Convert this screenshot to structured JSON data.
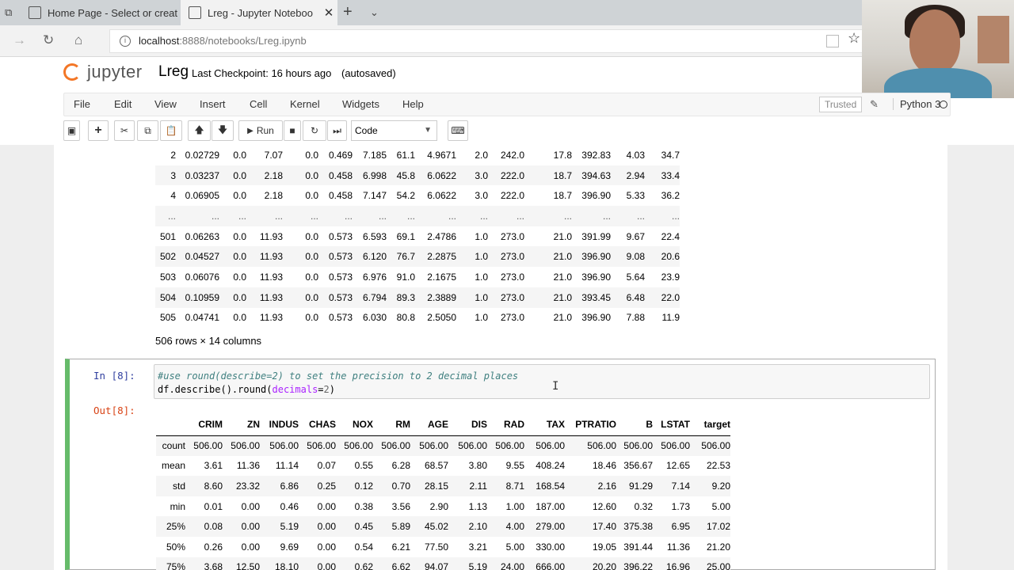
{
  "browser": {
    "tabs": [
      {
        "title": "Home Page - Select or creat"
      },
      {
        "title": "Lreg - Jupyter Noteboo"
      }
    ],
    "url": "localhost:8888/notebooks/Lreg.ipynb",
    "url_host": "localhost",
    "url_rest": ":8888/notebooks/Lreg.ipynb"
  },
  "jupyter": {
    "logo_text": "jupyter",
    "notebook_name": "Lreg",
    "checkpoint": "Last Checkpoint: 16 hours ago",
    "autosave": "(autosaved)",
    "menu": [
      "File",
      "Edit",
      "View",
      "Insert",
      "Cell",
      "Kernel",
      "Widgets",
      "Help"
    ],
    "trusted": "Trusted",
    "kernel": "Python 3",
    "toolbar": {
      "run_label": "Run",
      "cell_type": "Code"
    }
  },
  "top_frame": {
    "rows": [
      [
        "2",
        "0.02729",
        "0.0",
        "7.07",
        "0.0",
        "0.469",
        "7.185",
        "61.1",
        "4.9671",
        "2.0",
        "242.0",
        "17.8",
        "392.83",
        "4.03",
        "34.7"
      ],
      [
        "3",
        "0.03237",
        "0.0",
        "2.18",
        "0.0",
        "0.458",
        "6.998",
        "45.8",
        "6.0622",
        "3.0",
        "222.0",
        "18.7",
        "394.63",
        "2.94",
        "33.4"
      ],
      [
        "4",
        "0.06905",
        "0.0",
        "2.18",
        "0.0",
        "0.458",
        "7.147",
        "54.2",
        "6.0622",
        "3.0",
        "222.0",
        "18.7",
        "396.90",
        "5.33",
        "36.2"
      ],
      [
        "...",
        "...",
        "...",
        "...",
        "...",
        "...",
        "...",
        "...",
        "...",
        "...",
        "...",
        "...",
        "...",
        "...",
        "..."
      ],
      [
        "501",
        "0.06263",
        "0.0",
        "11.93",
        "0.0",
        "0.573",
        "6.593",
        "69.1",
        "2.4786",
        "1.0",
        "273.0",
        "21.0",
        "391.99",
        "9.67",
        "22.4"
      ],
      [
        "502",
        "0.04527",
        "0.0",
        "11.93",
        "0.0",
        "0.573",
        "6.120",
        "76.7",
        "2.2875",
        "1.0",
        "273.0",
        "21.0",
        "396.90",
        "9.08",
        "20.6"
      ],
      [
        "503",
        "0.06076",
        "0.0",
        "11.93",
        "0.0",
        "0.573",
        "6.976",
        "91.0",
        "2.1675",
        "1.0",
        "273.0",
        "21.0",
        "396.90",
        "5.64",
        "23.9"
      ],
      [
        "504",
        "0.10959",
        "0.0",
        "11.93",
        "0.0",
        "0.573",
        "6.794",
        "89.3",
        "2.3889",
        "1.0",
        "273.0",
        "21.0",
        "393.45",
        "6.48",
        "22.0"
      ],
      [
        "505",
        "0.04741",
        "0.0",
        "11.93",
        "0.0",
        "0.573",
        "6.030",
        "80.8",
        "2.5050",
        "1.0",
        "273.0",
        "21.0",
        "396.90",
        "7.88",
        "11.9"
      ]
    ],
    "shape": "506 rows × 14 columns"
  },
  "cell8": {
    "in_prompt": "In [8]:",
    "code_comment": "#use round(describe=2) to set the precision to 2 decimal places",
    "code_pre": "df.describe().round(",
    "code_kw": "decimals",
    "code_eq": "=",
    "code_num": "2",
    "code_post": ")",
    "out_prompt": "Out[8]:",
    "columns": [
      "",
      "CRIM",
      "ZN",
      "INDUS",
      "CHAS",
      "NOX",
      "RM",
      "AGE",
      "DIS",
      "RAD",
      "TAX",
      "PTRATIO",
      "B",
      "LSTAT",
      "target"
    ],
    "rows": [
      [
        "count",
        "506.00",
        "506.00",
        "506.00",
        "506.00",
        "506.00",
        "506.00",
        "506.00",
        "506.00",
        "506.00",
        "506.00",
        "506.00",
        "506.00",
        "506.00",
        "506.00"
      ],
      [
        "mean",
        "3.61",
        "11.36",
        "11.14",
        "0.07",
        "0.55",
        "6.28",
        "68.57",
        "3.80",
        "9.55",
        "408.24",
        "18.46",
        "356.67",
        "12.65",
        "22.53"
      ],
      [
        "std",
        "8.60",
        "23.32",
        "6.86",
        "0.25",
        "0.12",
        "0.70",
        "28.15",
        "2.11",
        "8.71",
        "168.54",
        "2.16",
        "91.29",
        "7.14",
        "9.20"
      ],
      [
        "min",
        "0.01",
        "0.00",
        "0.46",
        "0.00",
        "0.38",
        "3.56",
        "2.90",
        "1.13",
        "1.00",
        "187.00",
        "12.60",
        "0.32",
        "1.73",
        "5.00"
      ],
      [
        "25%",
        "0.08",
        "0.00",
        "5.19",
        "0.00",
        "0.45",
        "5.89",
        "45.02",
        "2.10",
        "4.00",
        "279.00",
        "17.40",
        "375.38",
        "6.95",
        "17.02"
      ],
      [
        "50%",
        "0.26",
        "0.00",
        "9.69",
        "0.00",
        "0.54",
        "6.21",
        "77.50",
        "3.21",
        "5.00",
        "330.00",
        "19.05",
        "391.44",
        "11.36",
        "21.20"
      ],
      [
        "75%",
        "3.68",
        "12.50",
        "18.10",
        "0.00",
        "0.62",
        "6.62",
        "94.07",
        "5.19",
        "24.00",
        "666.00",
        "20.20",
        "396.22",
        "16.96",
        "25.00"
      ]
    ]
  },
  "colors": {
    "accent_orange": "#f37626",
    "selected_cell_border": "#66bb6a",
    "in_prompt": "#303f9f",
    "out_prompt": "#d84315"
  },
  "icons": [
    "save-icon",
    "plus-icon",
    "scissors-icon",
    "copy-icon",
    "paste-icon",
    "arrow-up-icon",
    "arrow-down-icon",
    "play-icon",
    "stop-icon",
    "restart-icon",
    "fast-forward-icon",
    "keyboard-icon",
    "pencil-icon",
    "kernel-idle-icon",
    "star-icon"
  ]
}
